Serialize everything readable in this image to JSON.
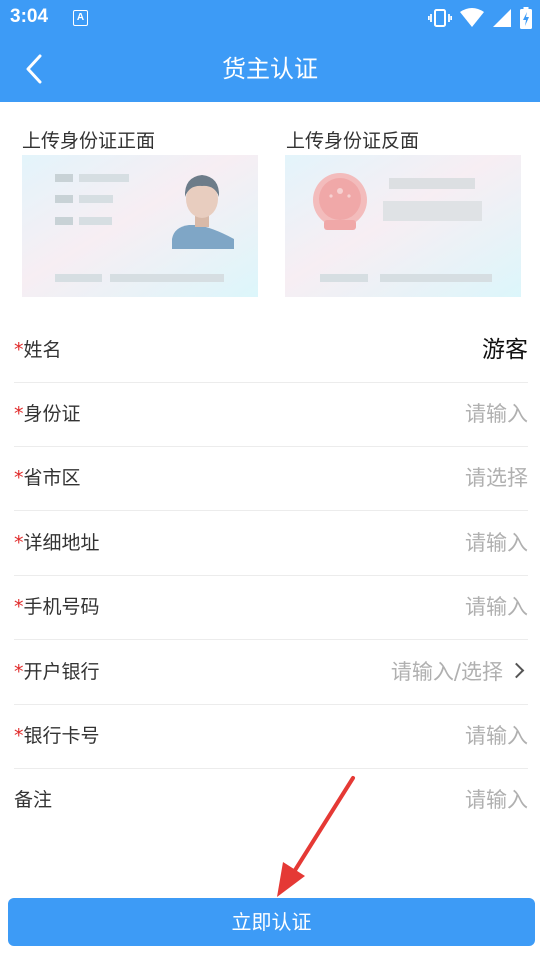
{
  "status_bar": {
    "time": "3:04",
    "notification_letter": "A"
  },
  "header": {
    "title": "货主认证"
  },
  "id_upload": {
    "front_label": "上传身份证正面",
    "back_label": "上传身份证反面"
  },
  "form": {
    "required_mark": "*",
    "rows": [
      {
        "label": "姓名",
        "required": true,
        "value": "游客"
      },
      {
        "label": "身份证",
        "required": true,
        "placeholder": "请输入"
      },
      {
        "label": "省市区",
        "required": true,
        "placeholder": "请选择"
      },
      {
        "label": "详细地址",
        "required": true,
        "placeholder": "请输入"
      },
      {
        "label": "手机号码",
        "required": true,
        "placeholder": "请输入"
      },
      {
        "label": "开户银行",
        "required": true,
        "placeholder": "请输入/选择"
      },
      {
        "label": "银行卡号",
        "required": true,
        "placeholder": "请输入"
      },
      {
        "label": "备注",
        "required": false,
        "placeholder": "请输入"
      }
    ]
  },
  "submit": {
    "label": "立即认证"
  },
  "colors": {
    "primary": "#3d9bf6",
    "required": "#e02a2a",
    "placeholder": "#b0b0b0",
    "annotation_arrow": "#e53935"
  }
}
